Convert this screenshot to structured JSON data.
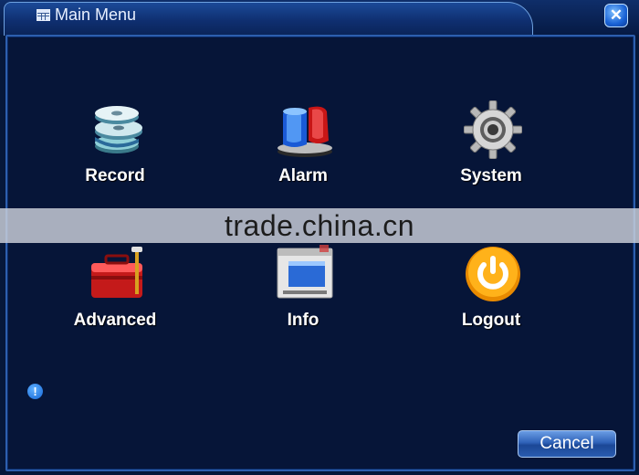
{
  "window": {
    "title": "Main Menu",
    "close_label": "✕"
  },
  "menu": {
    "items": [
      {
        "label": "Record",
        "icon": "film-reel-icon"
      },
      {
        "label": "Alarm",
        "icon": "alarm-siren-icon"
      },
      {
        "label": "System",
        "icon": "gear-icon"
      },
      {
        "label": "Advanced",
        "icon": "toolbox-icon"
      },
      {
        "label": "Info",
        "icon": "monitor-info-icon"
      },
      {
        "label": "Logout",
        "icon": "power-icon"
      }
    ]
  },
  "watermark": "trade.china.cn",
  "status": {
    "info_glyph": "!"
  },
  "footer": {
    "cancel_label": "Cancel"
  },
  "colors": {
    "background": "#061538",
    "accent": "#2d5fae",
    "text": "#ffffff"
  }
}
